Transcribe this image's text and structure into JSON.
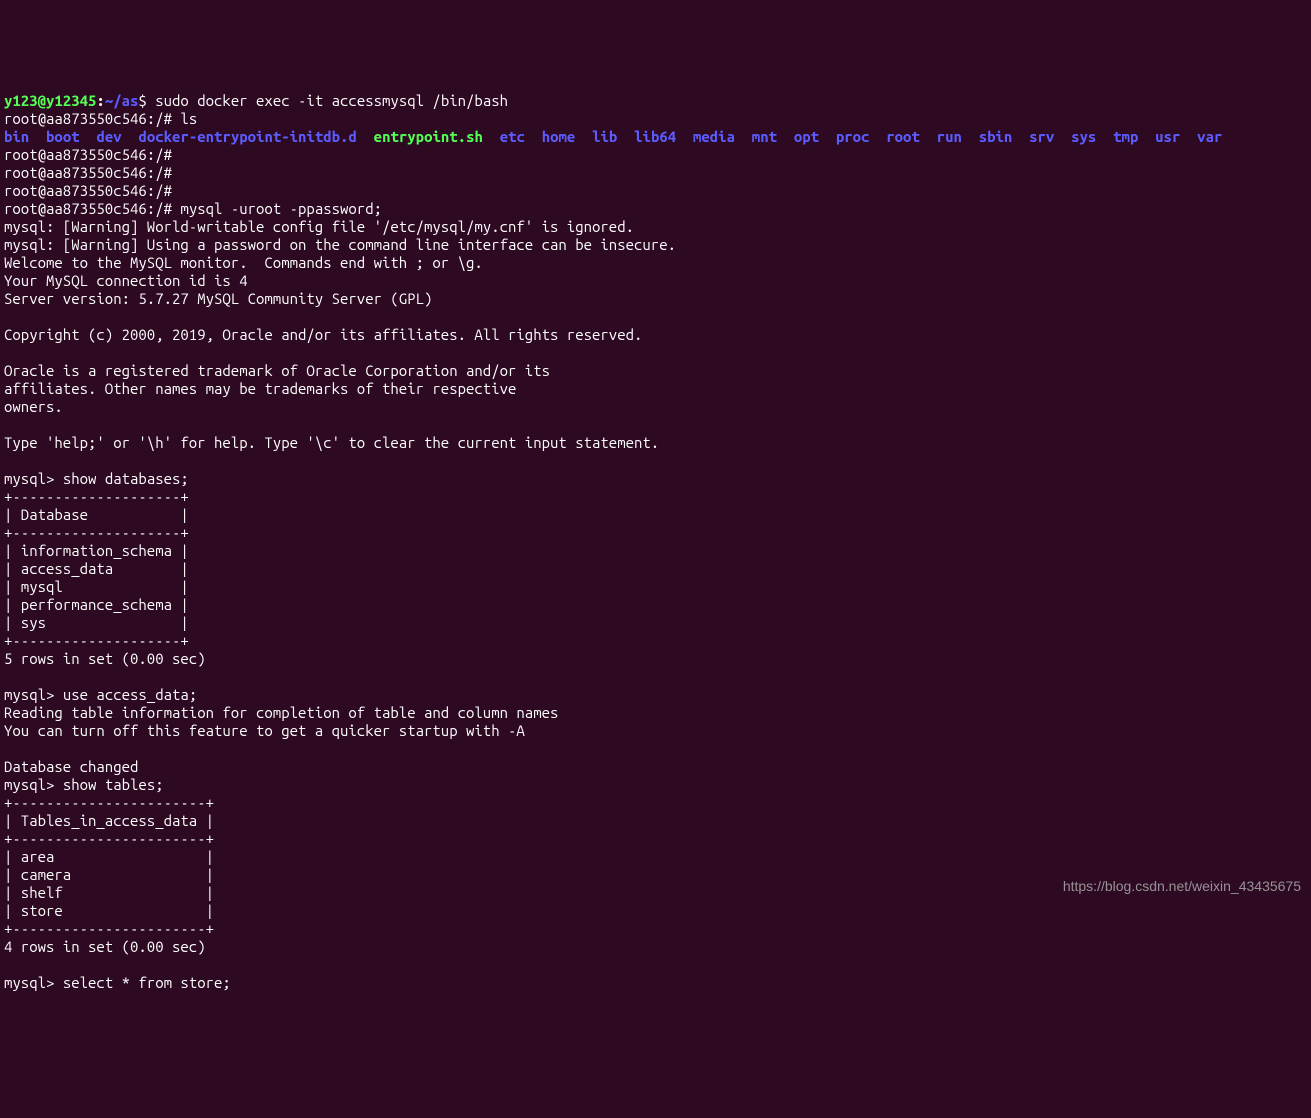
{
  "prompt": {
    "user": "y123@y12345",
    "sep1": ":",
    "path": "~/as",
    "sep2": "$ "
  },
  "commands": {
    "sudo_docker": "sudo docker exec -it accessmysql /bin/bash",
    "root_prompt": "root@aa873550c546:/#",
    "ls": "ls",
    "mysql_login": "mysql -uroot -ppassword;",
    "show_db": "show databases;",
    "use_db": "use access_data;",
    "show_tables": "show tables;",
    "select_store": "select * from store;"
  },
  "ls_output": {
    "items": [
      "bin",
      "boot",
      "dev",
      "docker-entrypoint-initdb.d",
      "entrypoint.sh",
      "etc",
      "home",
      "lib",
      "lib64",
      "media",
      "mnt",
      "opt",
      "proc",
      "root",
      "run",
      "sbin",
      "srv",
      "sys",
      "tmp",
      "usr",
      "var"
    ]
  },
  "mysql_output": {
    "warn1": "mysql: [Warning] World-writable config file '/etc/mysql/my.cnf' is ignored.",
    "warn2": "mysql: [Warning] Using a password on the command line interface can be insecure.",
    "welcome1": "Welcome to the MySQL monitor.  Commands end with ; or \\g.",
    "welcome2": "Your MySQL connection id is 4",
    "welcome3": "Server version: 5.7.27 MySQL Community Server (GPL)",
    "copyright": "Copyright (c) 2000, 2019, Oracle and/or its affiliates. All rights reserved.",
    "trademark1": "Oracle is a registered trademark of Oracle Corporation and/or its",
    "trademark2": "affiliates. Other names may be trademarks of their respective",
    "trademark3": "owners.",
    "help": "Type 'help;' or '\\h' for help. Type '\\c' to clear the current input statement.",
    "mysql_prompt": "mysql> "
  },
  "databases": {
    "border": "+--------------------+",
    "header": "| Database           |",
    "rows": [
      "| information_schema |",
      "| access_data        |",
      "| mysql              |",
      "| performance_schema |",
      "| sys                |"
    ],
    "summary": "5 rows in set (0.00 sec)"
  },
  "use_db_output": {
    "line1": "Reading table information for completion of table and column names",
    "line2": "You can turn off this feature to get a quicker startup with -A",
    "line3": "Database changed"
  },
  "tables": {
    "border": "+-----------------------+",
    "header": "| Tables_in_access_data |",
    "rows": [
      "| area                  |",
      "| camera                |",
      "| shelf                 |",
      "| store                 |"
    ],
    "summary": "4 rows in set (0.00 sec)"
  },
  "watermark": "https://blog.csdn.net/weixin_43435675"
}
